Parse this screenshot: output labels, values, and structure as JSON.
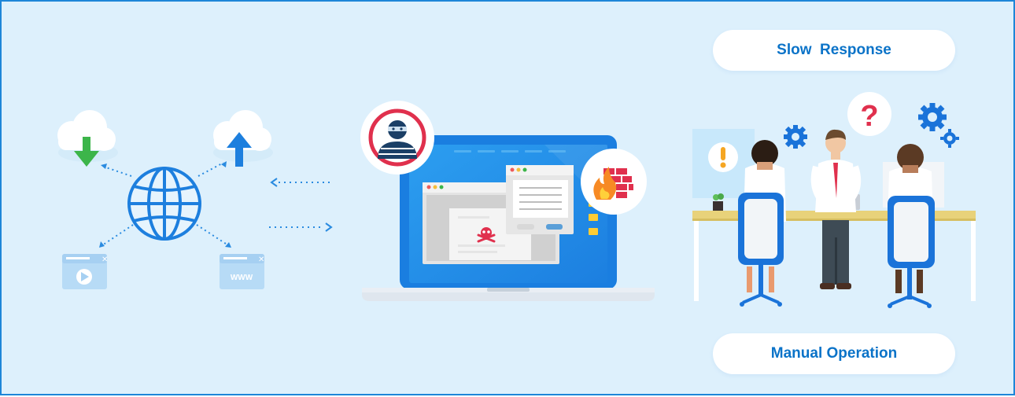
{
  "labels": {
    "slow_response": "Slow  Response",
    "manual_operation": "Manual Operation"
  },
  "icons": [
    "globe-icon",
    "cloud-download-icon",
    "cloud-upload-icon",
    "video-window-icon",
    "www-window-icon",
    "laptop-icon",
    "hacker-icon",
    "firewall-icon",
    "malware-skull-icon",
    "question-icon",
    "exclamation-icon",
    "gear-icon"
  ],
  "window_text": {
    "www": "WWW"
  },
  "colors": {
    "accent_blue": "#1d86d8",
    "background": "#ddf0fc",
    "danger_red": "#e0304d",
    "success_green": "#3cb54a"
  }
}
